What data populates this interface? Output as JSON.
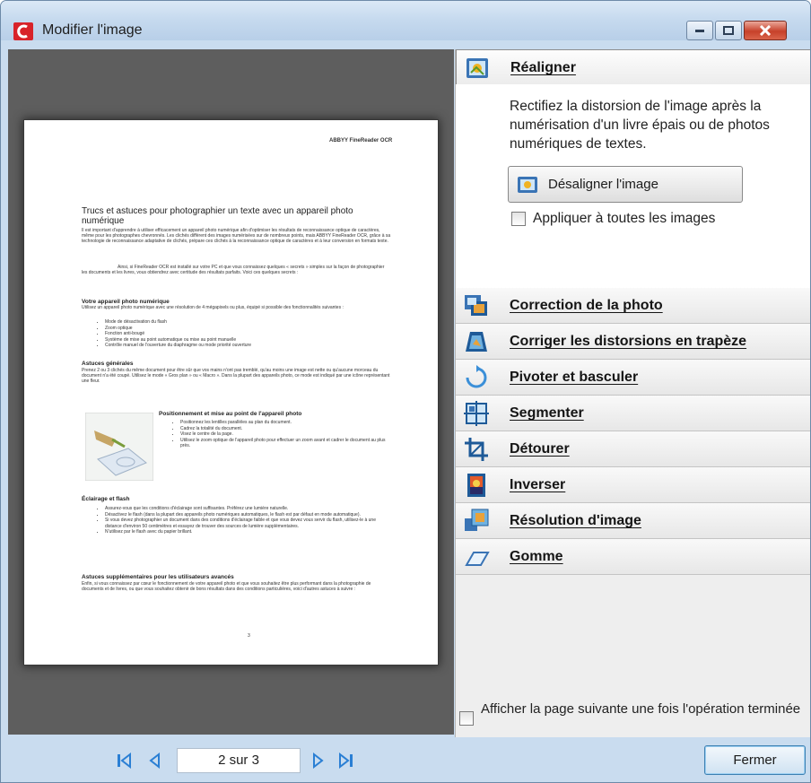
{
  "window": {
    "title": "Modifier l'image"
  },
  "document_preview": {
    "header": "ABBYY FineReader OCR",
    "title": "Trucs et astuces pour photographier un texte avec un appareil photo numérique",
    "intro": "Il est important d'apprendre à utiliser efficacement un appareil photo numérique afin d'optimiser les résultats de reconnaissance optique de caractères, même pour les photographes chevronnés. Les clichés diffèrent des images numérisées sur de nombreux points, mais ABBYY FineReader OCR, grâce à sa technologie de reconnaissance adaptative de clichés, prépare ces clichés à la reconnaissance optique de caractères et à leur conversion en formats texte.",
    "intro2": "Ainsi, si FineReader OCR est installé sur votre PC et que vous connaissez quelques « secrets » simples sur la façon de photographier les documents et les livres, vous obtiendrez avec certitude des résultats parfaits. Voici ces quelques secrets :",
    "section1_title": "Votre appareil photo numérique",
    "section1_text": "Utilisez un appareil photo numérique avec une résolution de 4 mégapixels ou plus, équipé si possible des fonctionnalités suivantes :",
    "section1_bullets": [
      "Mode de désactivation du flash",
      "Zoom optique",
      "Fonction anti-bougé",
      "Système de mise au point automatique ou mise au point manuelle",
      "Contrôle manuel de l'ouverture du diaphragme ou mode priorité ouverture"
    ],
    "section2_title": "Astuces générales",
    "section2_text": "Prenez 2 ou 3 clichés du même document pour être sûr que vos mains n'ont pas tremblé, qu'au moins une image est nette ou qu'aucune morceau du document n'a été coupé. Utilisez le mode « Gros plan » ou « Macro ». Dans la plupart des appareils photo, ce mode est indiqué par une icône représentant une fleur.",
    "section3_title": "Positionnement et mise au point de l'appareil photo",
    "section3_bullets": [
      "Positionnez les lentilles parallèles au plan du document.",
      "Cadrez la totalité du document.",
      "Visez le centre de la page.",
      "Utilisez le zoom optique de l'appareil photo pour effectuer un zoom avant et cadrer le document au plus près."
    ],
    "section4_title": "Éclairage et flash",
    "section4_bullets": [
      "Assurez-vous que les conditions d'éclairage sont suffisantes. Préférez une lumière naturelle.",
      "Désactivez le flash (dans la plupart des appareils photo numériques automatiques, le flash est par défaut en mode automatique).",
      "Si vous devez photographier un document dans des conditions d'éclairage faible et que vous devez vous servir du flash, utilisez-le à une distance d'environ 50 centimètres et essayez de trouver des sources de lumière supplémentaires.",
      "N'utilisez par le flash avec du papier brillant."
    ],
    "section5_title": "Astuces supplémentaires pour les utilisateurs avancés",
    "section5_text": "Enfin, si vous connaissez par cœur le fonctionnement de votre appareil photo et que vous souhaitez être plus performant dans la photographie de documents et de livres, ou que vous souhaitez obtenir de bons résultats dans des conditions particulières, voici d'autres astuces à suivre :",
    "page_number": "3"
  },
  "tools": {
    "realigner": {
      "label": "Réaligner",
      "description": "Rectifiez la distorsion de l'image après la numérisation d'un livre épais ou de photos numériques de textes.",
      "button_label": "Désaligner l'image",
      "apply_all_label": "Appliquer à toutes les images",
      "apply_all_checked": false
    },
    "items": [
      {
        "label": "Correction de la photo",
        "icon": "photo-correction-icon"
      },
      {
        "label": "Corriger les distorsions en trapèze",
        "icon": "trapezoid-icon"
      },
      {
        "label": "Pivoter et basculer",
        "icon": "rotate-icon"
      },
      {
        "label": "Segmenter",
        "icon": "split-icon"
      },
      {
        "label": "Détourer",
        "icon": "crop-icon"
      },
      {
        "label": "Inverser",
        "icon": "invert-icon"
      },
      {
        "label": "Résolution d'image",
        "icon": "resolution-icon"
      },
      {
        "label": "Gomme",
        "icon": "eraser-icon"
      }
    ]
  },
  "footer_option": {
    "label": "Afficher la page suivante une fois l'opération terminée",
    "checked": false
  },
  "navigation": {
    "page_indicator": "2 sur 3"
  },
  "actions": {
    "close_label": "Fermer"
  },
  "colors": {
    "window_frame": "#c9dcef",
    "preview_background": "#5e5e5e",
    "close_button": "#c7412a"
  }
}
